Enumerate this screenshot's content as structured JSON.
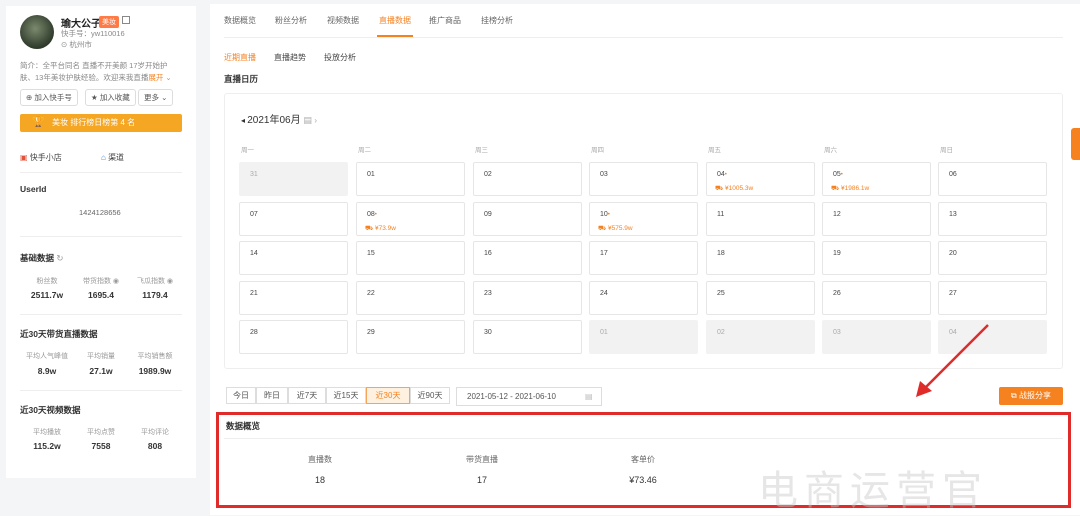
{
  "profile": {
    "name": "瑜大公子",
    "tag": "美妆",
    "id_text": "快手号：yw110016",
    "location": "杭州市",
    "intro_line1": "简介：全平台同名 直播不开美颜 17岁开始护",
    "intro_line2": "肤、13年美妆护肤经验。欢迎来我直播",
    "expand": "展开",
    "follow_btn": "加入快手号",
    "fav_btn": "加入收藏",
    "more_btn": "更多",
    "rank_text": "美妆 排行榜日榜第 4 名",
    "shop_label": "快手小店",
    "store_label": "渠道"
  },
  "userid": {
    "title": "UserId",
    "value": "1424128656"
  },
  "basic": {
    "title": "基础数据",
    "stats": [
      {
        "label": "粉丝数",
        "value": "2511.7w"
      },
      {
        "label": "带货指数",
        "value": "1695.4"
      },
      {
        "label": "飞瓜指数",
        "value": "1179.4"
      }
    ]
  },
  "live30": {
    "title": "近30天带货直播数据",
    "stats": [
      {
        "label": "平均人气峰值",
        "value": "8.9w"
      },
      {
        "label": "平均销量",
        "value": "27.1w"
      },
      {
        "label": "平均销售额",
        "value": "1989.9w"
      }
    ]
  },
  "video30": {
    "title": "近30天视频数据",
    "stats": [
      {
        "label": "平均播放",
        "value": "115.2w"
      },
      {
        "label": "平均点赞",
        "value": "7558"
      },
      {
        "label": "平均评论",
        "value": "808"
      }
    ]
  },
  "tabs": [
    "数据概览",
    "粉丝分析",
    "视频数据",
    "直播数据",
    "推广商品",
    "挂榜分析"
  ],
  "subtabs": [
    "近期直播",
    "直播趋势",
    "投放分析"
  ],
  "calendar": {
    "title": "直播日历",
    "month": "2021年06月",
    "weekdays": [
      "周一",
      "周二",
      "周三",
      "周四",
      "周五",
      "周六",
      "周日"
    ],
    "rows": [
      [
        {
          "d": "31",
          "g": true
        },
        {
          "d": "01"
        },
        {
          "d": "02"
        },
        {
          "d": "03"
        },
        {
          "d": "04",
          "dot": "•",
          "amt": "¥1005.3w"
        },
        {
          "d": "05",
          "dot": "•",
          "amt": "¥1986.1w"
        },
        {
          "d": "06"
        }
      ],
      [
        {
          "d": "07"
        },
        {
          "d": "08",
          "dot": "•",
          "amt": "¥73.9w"
        },
        {
          "d": "09"
        },
        {
          "d": "10",
          "dot": "•",
          "amt": "¥575.9w"
        },
        {
          "d": "11"
        },
        {
          "d": "12"
        },
        {
          "d": "13"
        }
      ],
      [
        {
          "d": "14"
        },
        {
          "d": "15"
        },
        {
          "d": "16"
        },
        {
          "d": "17"
        },
        {
          "d": "18"
        },
        {
          "d": "19"
        },
        {
          "d": "20"
        }
      ],
      [
        {
          "d": "21"
        },
        {
          "d": "22"
        },
        {
          "d": "23"
        },
        {
          "d": "24"
        },
        {
          "d": "25"
        },
        {
          "d": "26"
        },
        {
          "d": "27"
        }
      ],
      [
        {
          "d": "28"
        },
        {
          "d": "29"
        },
        {
          "d": "30"
        },
        {
          "d": "01",
          "g": true
        },
        {
          "d": "02",
          "g": true
        },
        {
          "d": "03",
          "g": true
        },
        {
          "d": "04",
          "g": true
        }
      ]
    ]
  },
  "ranges": [
    "今日",
    "昨日",
    "近7天",
    "近15天",
    "近30天",
    "近90天"
  ],
  "active_range": "近30天",
  "date_range": "2021-05-12 - 2021-06-10",
  "share_label": "战报分享",
  "overview": {
    "title": "数据概览",
    "items": [
      {
        "label": "直播数",
        "value": "18"
      },
      {
        "label": "带货直播",
        "value": "17"
      },
      {
        "label": "客单价",
        "value": "¥73.46"
      }
    ]
  },
  "watermark": "电商运营官",
  "colors": {
    "accent": "#f5811f",
    "highlight_box": "#e02b2b",
    "arrow": "#e02b2b"
  }
}
